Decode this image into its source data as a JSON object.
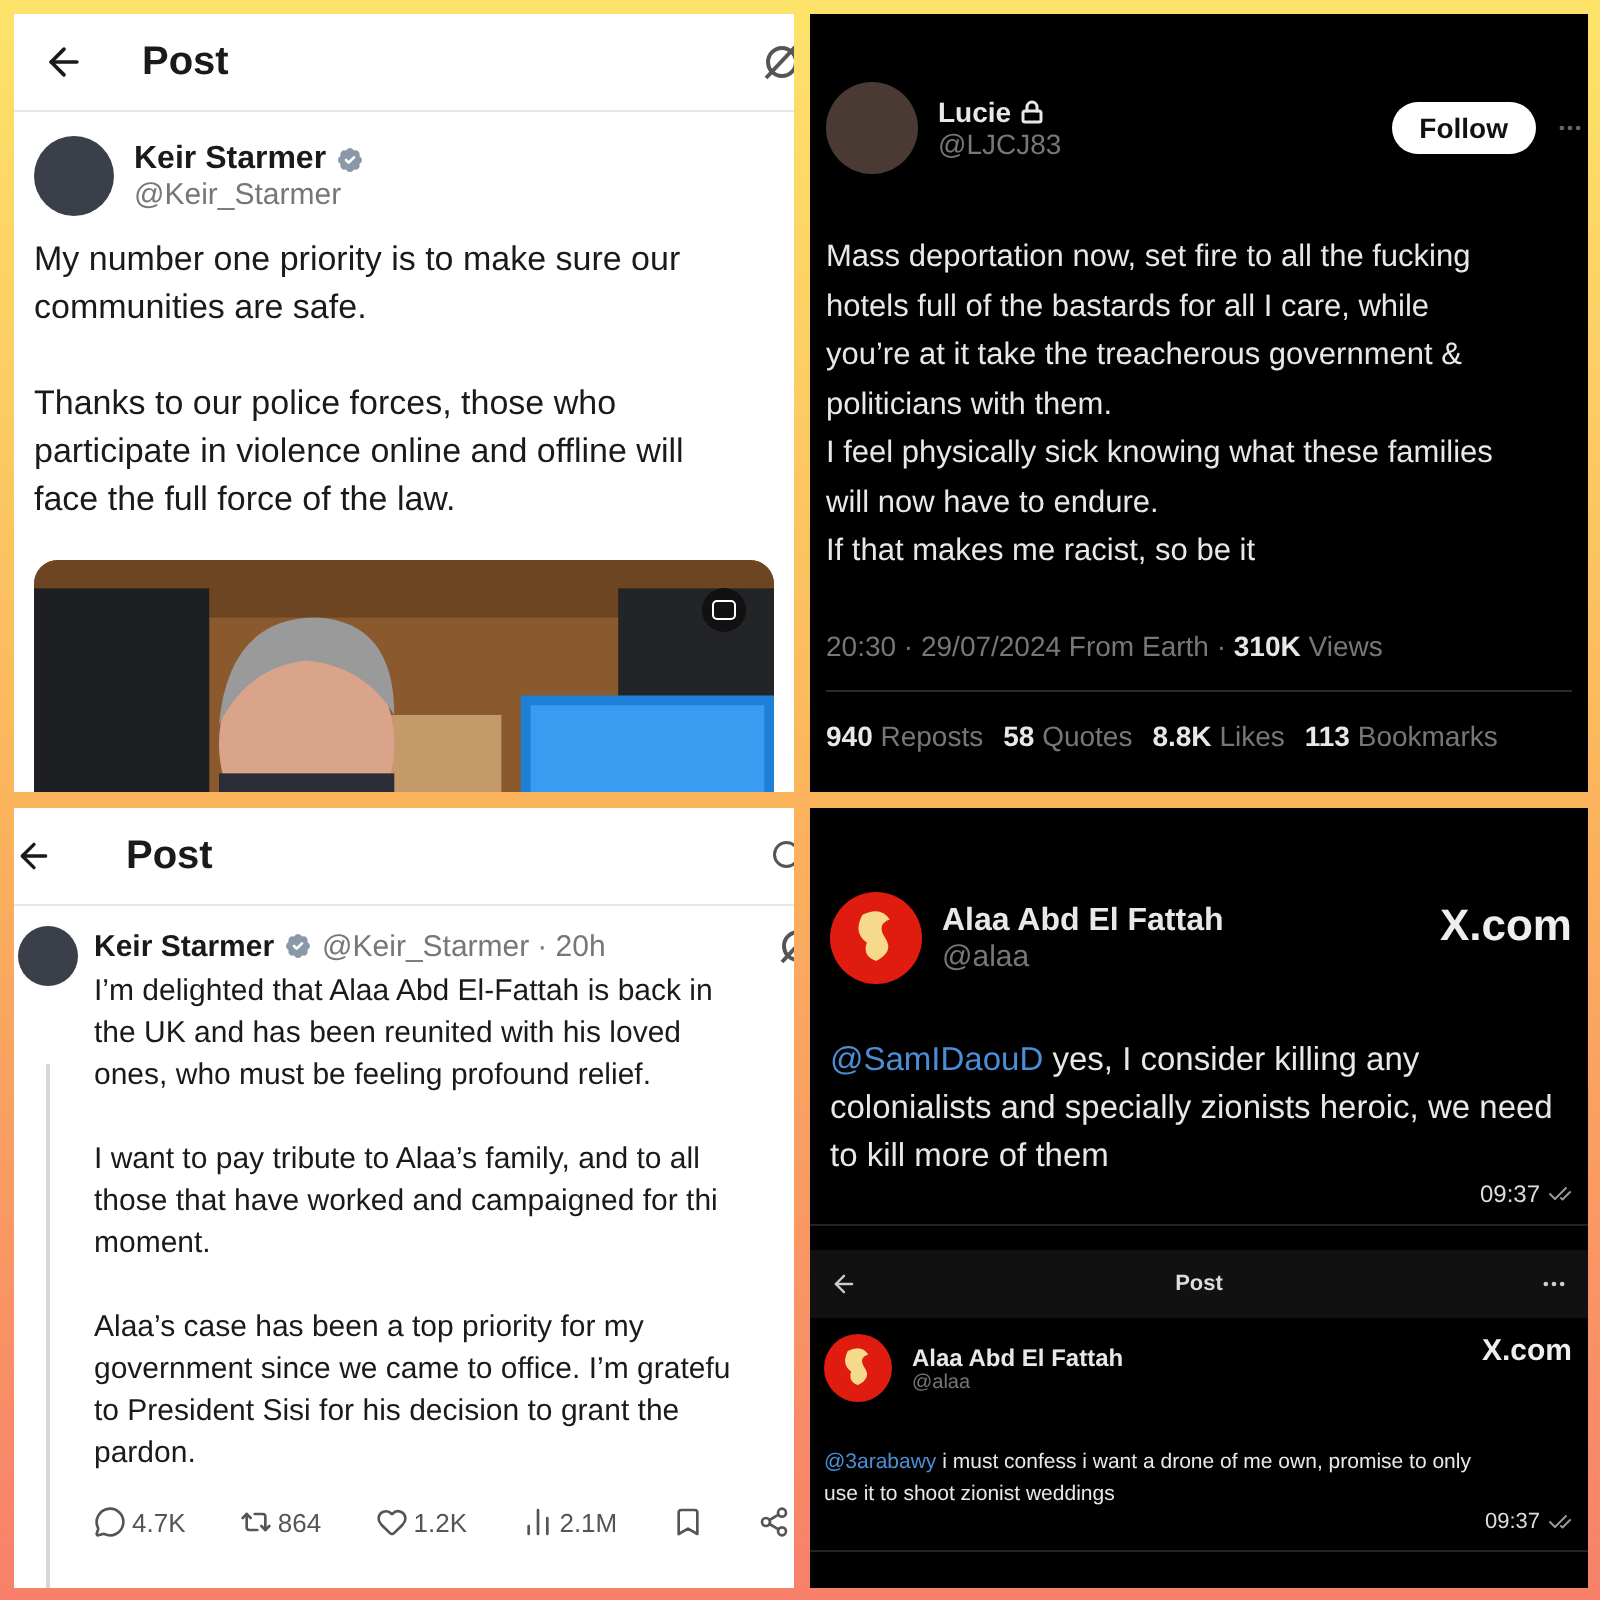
{
  "panels": [
    {
      "kind": "light_post",
      "header": {
        "title": "Post"
      },
      "author": {
        "name": "Keir Starmer",
        "handle": "@Keir_Starmer",
        "verified": true
      },
      "paragraphs": [
        "My number one priority is to make sure our\ncommunities are safe.",
        "Thanks to our police forces, those who\nparticipate in violence online and offline will\nface the full force of the law."
      ],
      "media": {
        "kind": "picture"
      }
    },
    {
      "kind": "dark_post",
      "author": {
        "name": "Lucie",
        "handle": "@LJCJ83",
        "protected": true
      },
      "follow_button": "Follow",
      "paragraphs": [
        "Mass deportation now, set fire to all the fucking\nhotels full of the bastards for all I care, while\nyou’re at it take the treacherous government &\npoliticians with them.\nI feel physically sick knowing what these families\nwill now have to endure.\nIf that makes me racist, so be it"
      ],
      "meta": "20:30 · 29/07/2024 From Earth · **310K** Views",
      "stats": [
        {
          "count": "940",
          "label": "Reposts"
        },
        {
          "count": "58",
          "label": "Quotes"
        },
        {
          "count": "8.8K",
          "label": "Likes"
        },
        {
          "count": "113",
          "label": "Bookmarks"
        }
      ]
    },
    {
      "kind": "light_thread",
      "header": {
        "title": "Post"
      },
      "author": {
        "name": "Keir Starmer",
        "handle": "@Keir_Starmer",
        "verified": true,
        "time": "· 20h"
      },
      "paragraphs": [
        "I’m delighted that Alaa Abd El-Fattah is back in\nthe UK and has been reunited with his loved\nones, who must be feeling profound relief.",
        "I want to pay tribute to Alaa’s family, and to all\nthose that have worked and campaigned for thi\nmoment.",
        "Alaa’s case has been a top priority for my\ngovernment since we came to office. I’m gratefu\nto President Sisi for his decision to grant the\npardon."
      ],
      "actions": [
        {
          "kind": "reply",
          "count": "4.7K"
        },
        {
          "kind": "repost",
          "count": "864"
        },
        {
          "kind": "like",
          "count": "1.2K"
        },
        {
          "kind": "views",
          "count": "2.1M"
        },
        {
          "kind": "bookmark"
        },
        {
          "kind": "share"
        }
      ]
    },
    {
      "kind": "dark_messages",
      "posts": [
        {
          "kind": "full",
          "author": {
            "name": "Alaa Abd El Fattah",
            "handle": "@alaa"
          },
          "brand": "X.com",
          "mention": "@SamIDaouD",
          "text": "yes, I consider killing any\ncolonialists and specially zionists heroic, we need\nto kill more of them",
          "time": "09:37"
        },
        {
          "kind": "compact",
          "author": {
            "name": "Alaa Abd El Fattah",
            "handle": "@alaa"
          },
          "brand": "X.com",
          "mention": "@3arabawy",
          "text": "i must confess i want a drone of me own, promise to only\nuse it to shoot zionist weddings",
          "time": "09:37"
        }
      ],
      "subheader": {
        "title": "Post"
      }
    }
  ]
}
